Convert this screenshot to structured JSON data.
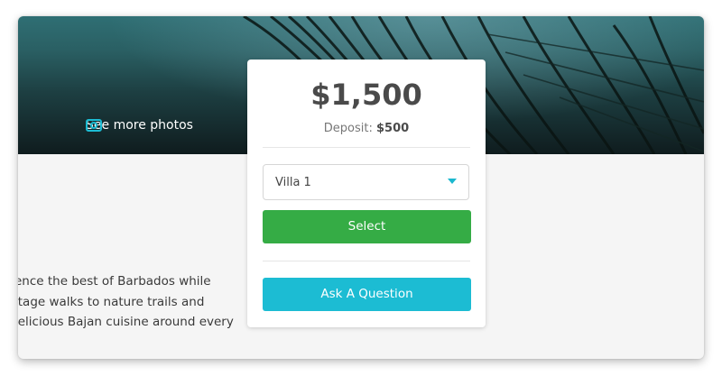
{
  "hero": {
    "see_more_photos": "See more photos",
    "icon": "camera-icon"
  },
  "description_lines": [
    "ence the best of Barbados while",
    "itage walks to nature trails and",
    "lelicious Bajan cuisine around every"
  ],
  "booking_card": {
    "price": "$1,500",
    "deposit_label": "Deposit:",
    "deposit_value": "$500",
    "villa_select": {
      "selected": "Villa 1"
    },
    "select_button": "Select",
    "ask_button": "Ask A Question"
  },
  "colors": {
    "select_button": "#35ac45",
    "ask_button": "#1cbcd3",
    "caret": "#1bb8cf"
  }
}
